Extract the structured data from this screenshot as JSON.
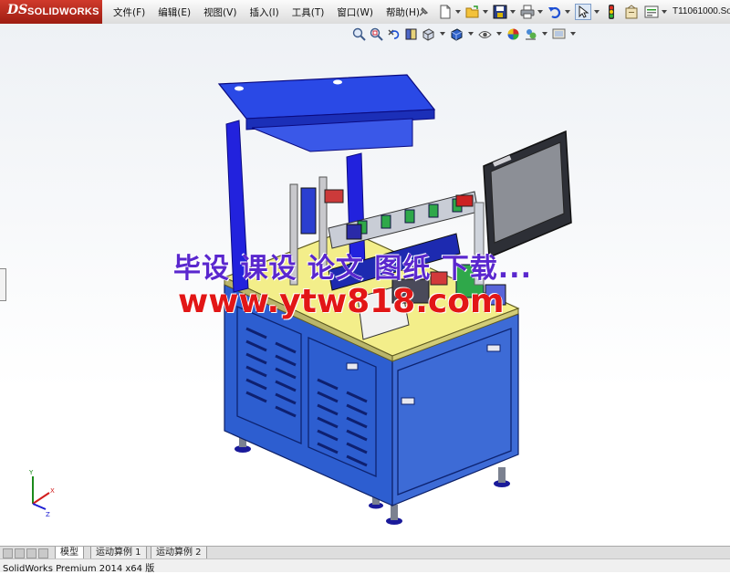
{
  "app": {
    "logo_ds": "DS",
    "logo_text": "SOLIDWORKS",
    "document_title": "T11061000.So"
  },
  "menu": {
    "items": [
      "文件(F)",
      "编辑(E)",
      "视图(V)",
      "插入(I)",
      "工具(T)",
      "窗口(W)",
      "帮助(H)"
    ]
  },
  "toolbar": {
    "icons": [
      "pin-icon",
      "new-document-icon",
      "open-folder-icon",
      "save-icon",
      "print-icon",
      "undo-icon",
      "select-arrow-icon",
      "rebuild-traffic-light-icon",
      "file-properties-icon",
      "options-icon"
    ]
  },
  "heads_up_toolbar": {
    "icons": [
      "zoom-to-fit-icon",
      "zoom-to-area-icon",
      "previous-view-icon",
      "section-view-icon",
      "view-orientation-icon",
      "display-style-icon",
      "hide-show-items-icon",
      "edit-appearance-icon",
      "apply-scene-icon",
      "view-settings-icon"
    ]
  },
  "watermark": {
    "line1": "毕设 课设 论文 图纸 下载...",
    "line2": "www.ytw818.com"
  },
  "tabs": {
    "items": [
      "模型",
      "运动算例 1",
      "运动算例 2"
    ],
    "active_index": 0
  },
  "status": {
    "text": "SolidWorks Premium 2014 x64 版"
  },
  "colors": {
    "machine_blue": "#2f5fd6",
    "frame_blue": "#1f1fd8",
    "table_yellow": "#f3ee8a",
    "watermark_purple": "#5a27ce",
    "watermark_red": "#e21616",
    "logo_red": "#c22b1f"
  }
}
